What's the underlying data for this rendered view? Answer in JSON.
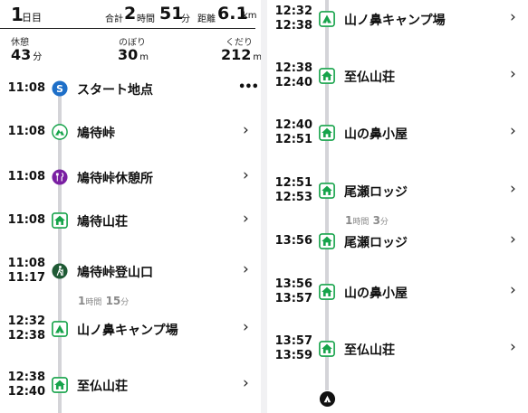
{
  "header": {
    "day_number": "1",
    "day_label": "日目",
    "total_label": "合計",
    "total_hours": "2",
    "hours_unit": "時間",
    "total_minutes": "51",
    "minutes_unit": "分",
    "distance_label": "距離",
    "distance_value": "6.1",
    "distance_unit": "km"
  },
  "stats": {
    "rest_label": "休憩",
    "rest_value": "43",
    "rest_unit": "分",
    "up_label": "のぼり",
    "up_value": "30",
    "up_unit": "m",
    "down_label": "くだり",
    "down_value": "212",
    "down_unit": "m"
  },
  "left_timeline": {
    "rows": [
      {
        "time1": "11:08",
        "time2": "",
        "name": "スタート地点",
        "icon": "start-s-icon",
        "action": "more-dots"
      },
      {
        "time1": "11:08",
        "time2": "",
        "name": "鳩待峠",
        "icon": "pass-peak-icon",
        "action": "chevron"
      },
      {
        "time1": "11:08",
        "time2": "",
        "name": "鳩待峠休憩所",
        "icon": "restaurant-icon",
        "action": "chevron"
      },
      {
        "time1": "11:08",
        "time2": "",
        "name": "鳩待山荘",
        "icon": "hut-icon",
        "action": "chevron"
      },
      {
        "time1": "11:08",
        "time2": "11:17",
        "name": "鳩待峠登山口",
        "icon": "trailhead-hiker-icon",
        "action": "chevron"
      },
      {
        "time1": "12:32",
        "time2": "12:38",
        "name": "山ノ鼻キャンプ場",
        "icon": "campsite-tent-icon",
        "action": "chevron"
      },
      {
        "time1": "12:38",
        "time2": "12:40",
        "name": "至仏山荘",
        "icon": "hut-icon",
        "action": "chevron"
      }
    ],
    "gap": {
      "hours": "1",
      "hours_unit": "時間",
      "minutes": "15",
      "minutes_unit": "分"
    }
  },
  "right_timeline": {
    "rows": [
      {
        "time1": "12:32",
        "time2": "12:38",
        "name": "山ノ鼻キャンプ場",
        "icon": "campsite-tent-icon",
        "action": "chevron"
      },
      {
        "time1": "12:38",
        "time2": "12:40",
        "name": "至仏山荘",
        "icon": "hut-icon",
        "action": "chevron"
      },
      {
        "time1": "12:40",
        "time2": "12:51",
        "name": "山の鼻小屋",
        "icon": "hut-icon",
        "action": "chevron"
      },
      {
        "time1": "12:51",
        "time2": "12:53",
        "name": "尾瀬ロッジ",
        "icon": "hut-icon",
        "action": "chevron"
      },
      {
        "time1": "13:56",
        "time2": "",
        "name": "尾瀬ロッジ",
        "icon": "hut-icon",
        "action": "chevron"
      },
      {
        "time1": "13:56",
        "time2": "13:57",
        "name": "山の鼻小屋",
        "icon": "hut-icon",
        "action": "chevron"
      },
      {
        "time1": "13:57",
        "time2": "13:59",
        "name": "至仏山荘",
        "icon": "hut-icon",
        "action": "chevron"
      }
    ],
    "gap": {
      "hours": "1",
      "hours_unit": "時間",
      "minutes": "3",
      "minutes_unit": "分"
    }
  },
  "colors": {
    "accent_blue": "#1e6fc8",
    "hut_green": "#16a34a",
    "restaurant_purple": "#7a1fa2",
    "trailhead_dark": "#1f5a35",
    "line_gray": "#d4d4d8",
    "gap_gray": "#8a8a8a"
  }
}
